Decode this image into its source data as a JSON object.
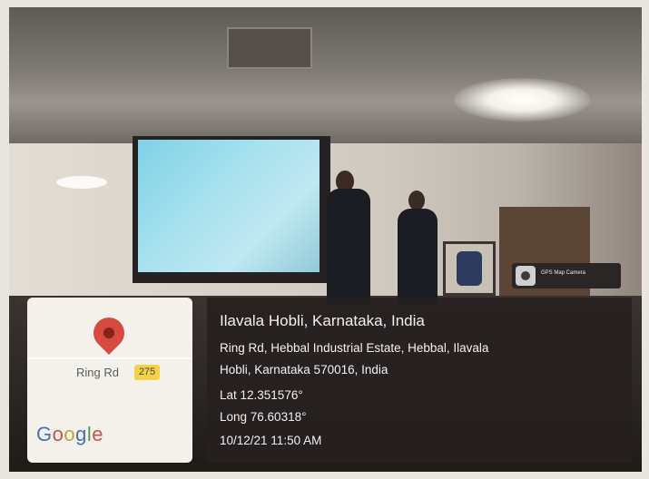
{
  "photo": {
    "description_free": true
  },
  "map_thumbnail": {
    "road_label": "Ring Rd",
    "road_number": "275",
    "google_letters": [
      "G",
      "o",
      "o",
      "g",
      "l",
      "e"
    ]
  },
  "badge": {
    "text": "GPS Map Camera"
  },
  "location": {
    "title": "Ilavala Hobli, Karnataka, India",
    "address_line1": "Ring Rd, Hebbal Industrial Estate, Hebbal, Ilavala",
    "address_line2": "Hobli, Karnataka 570016, India",
    "lat": "Lat 12.351576°",
    "long": "Long 76.60318°",
    "datetime": "10/12/21 11:50 AM"
  },
  "colors": {
    "pin": "#d64a40",
    "panel": "#262020",
    "shield": "#f3d24a"
  }
}
